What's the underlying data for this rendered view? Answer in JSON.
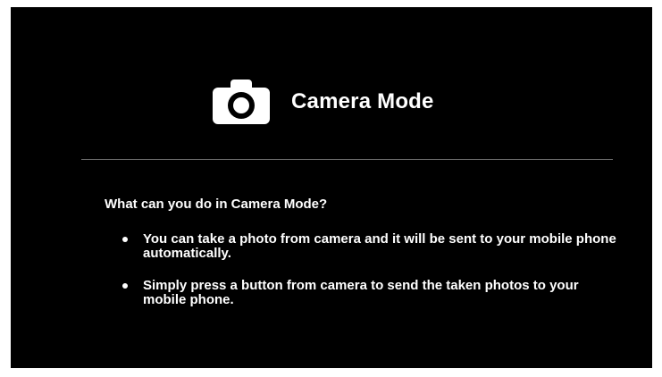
{
  "screen": {
    "background": "#000000",
    "icon": "camera-icon",
    "title": "Camera Mode",
    "question": "What can you do in Camera Mode?",
    "bullets": [
      {
        "text": "You can take a photo from camera and it will be sent to your mobile phone automatically."
      },
      {
        "text": "Simply press a button from camera to send the taken photos to your mobile phone."
      }
    ]
  }
}
